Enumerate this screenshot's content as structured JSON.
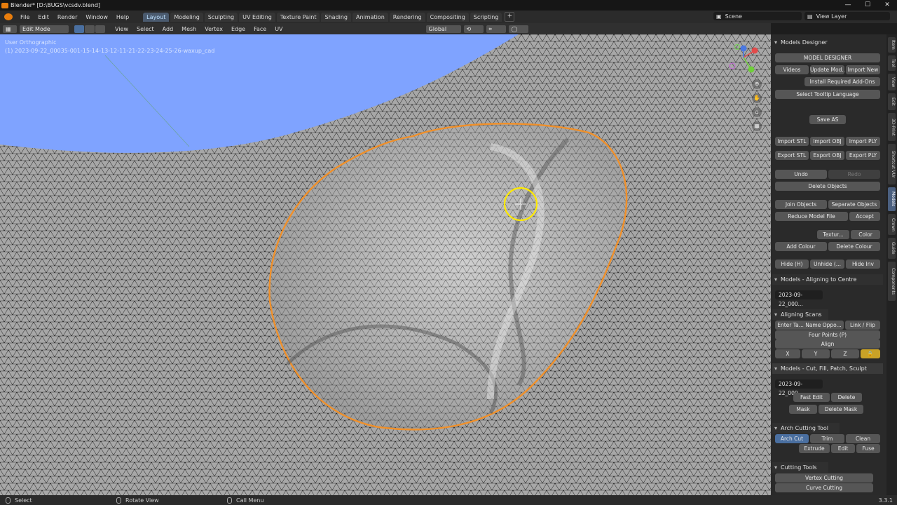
{
  "window": {
    "title": "Blender* [D:\\BUGS\\vcsdv.blend]",
    "controls": [
      "—",
      "☐",
      "✕"
    ]
  },
  "menubar": {
    "items": [
      "File",
      "Edit",
      "Render",
      "Window",
      "Help"
    ]
  },
  "workspaces": [
    "Layout",
    "Modeling",
    "Sculpting",
    "UV Editing",
    "Texture Paint",
    "Shading",
    "Animation",
    "Rendering",
    "Compositing",
    "Scripting"
  ],
  "scene": {
    "name": "Scene",
    "view_layer": "View Layer"
  },
  "header": {
    "mode": "Edit Mode",
    "menus": [
      "View",
      "Select",
      "Add",
      "Mesh",
      "Vertex",
      "Edge",
      "Face",
      "UV"
    ],
    "orientation": "Global"
  },
  "viewport": {
    "view_name": "User Orthographic",
    "object_name": "(1) 2023-09-22_00035-001-15-14-13-12-11-21-22-23-24-25-26-waxup_cad"
  },
  "panel": {
    "designer_title": "Models Designer",
    "model_designer": "MODEL DESIGNER",
    "videos": "Videos",
    "update_models": "Update Mod...",
    "import_new": "Import New",
    "install_addons": "Install Required Add-Ons",
    "tooltip_language": "Select Tooltip Language",
    "save_as": "Save AS",
    "import_stl": "Import STL",
    "import_obj": "Import OBJ",
    "import_ply": "Import PLY",
    "export_stl": "Export STL",
    "export_obj": "Export OBJ",
    "export_ply": "Export PLY",
    "undo": "Undo",
    "redo": "Redo",
    "delete_objects": "Delete Objects",
    "join_objects": "Join Objects",
    "separate_objects": "Separate Objects",
    "reduce_model": "Reduce Model File",
    "accept": "Accept",
    "texture": "Textur...",
    "colour": "Color",
    "add_colour": "Add Colour",
    "delete_colour": "Delete Colour",
    "hide": "Hide (H)",
    "unhide": "Unhide (...",
    "hide_inv": "Hide Inv",
    "aligning_header": "Models - Aligning to Centre",
    "object_field": "2023-09-22_000...",
    "aligning_scans": "Aligning Scans",
    "enter_name": "Enter Ta... Name Oppo...",
    "link_flip": "Link / Flip",
    "four_points": "Four Points (P)",
    "align": "Align",
    "axis_x": "X",
    "axis_y": "Y",
    "axis_z": "Z",
    "cut_header": "Models - Cut, Fill, Patch, Sculpt",
    "object_field2": "2023-09-22_000...",
    "fast_edit": "Fast Edit",
    "delete": "Delete",
    "mask": "Mask",
    "delete_mask": "Delete Mask",
    "arch_cutting_tool": "Arch Cutting Tool",
    "arch_cut": "Arch Cut",
    "trim": "Trim",
    "clean": "Clean",
    "extrude": "Extrude",
    "edit": "Edit",
    "fuse": "Fuse",
    "cutting_tools": "Cutting Tools",
    "vertex_cutting": "Vertex Cutting",
    "curve_cutting": "Curve Cutting"
  },
  "ntabs": [
    "Item",
    "Tool",
    "View",
    "Edit",
    "3D-Print",
    "Shortcut VUr",
    "Models",
    "Crown",
    "Guide",
    "Components"
  ],
  "statusbar": {
    "select": "Select",
    "rotate": "Rotate View",
    "call_menu": "Call Menu",
    "version": "3.3.1"
  },
  "colors": {
    "accent": "#e87d0d",
    "active_tab": "#4a5a6e",
    "sky": "#7fa3ff",
    "mesh": "#a7a7a7",
    "selection": "#f0902a",
    "cursor": "#ffea00"
  }
}
